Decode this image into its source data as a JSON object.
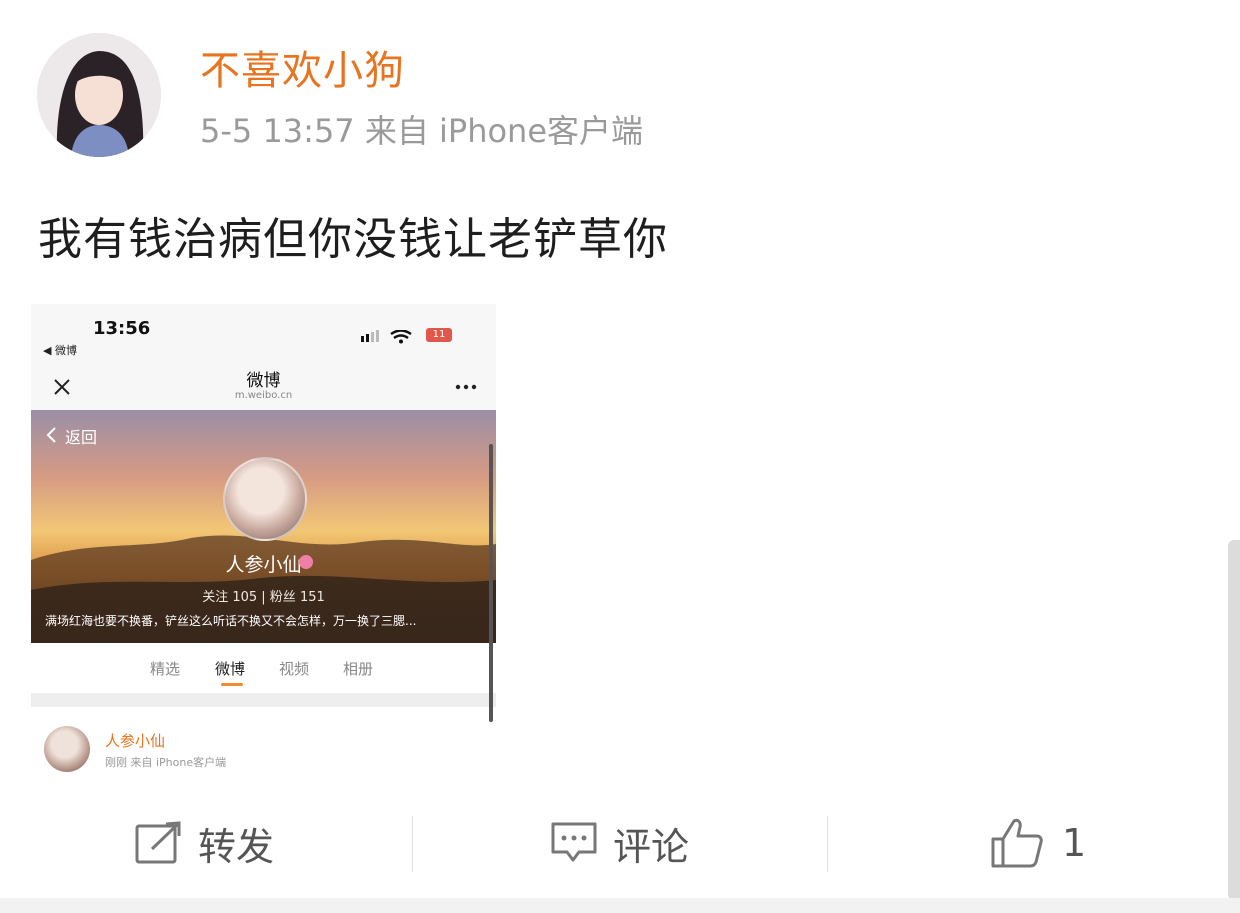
{
  "post": {
    "author": "不喜欢小狗",
    "meta": "5-5 13:57 来自 iPhone客户端",
    "text": "我有钱治病但你没钱让老铲草你"
  },
  "embedded": {
    "time": "13:56",
    "back_app": "◀ 微博",
    "battery": "11",
    "nav_title": "微博",
    "nav_domain": "m.weibo.cn",
    "back_label": "返回",
    "profile_name": "人参小仙",
    "stats": "关注 105  |  粉丝 151",
    "bio": "满场红海也要不换番，铲丝这么听话不换又不会怎样，万一换了三腮...",
    "tabs": [
      "精选",
      "微博",
      "视频",
      "相册"
    ],
    "feed_name": "人参小仙",
    "feed_meta": "刚刚 来自 iPhone客户端"
  },
  "actions": {
    "repost_label": "转发",
    "comment_label": "评论",
    "like_count": "1"
  },
  "icons": [
    "close-icon",
    "more-icon",
    "signal-icon",
    "wifi-icon",
    "battery-icon",
    "chevron-left-icon",
    "repost-icon",
    "comment-icon",
    "like-icon"
  ],
  "colors": {
    "author": "#e8741f",
    "meta": "#9a9a9a",
    "tab_accent": "#f18c2e"
  }
}
